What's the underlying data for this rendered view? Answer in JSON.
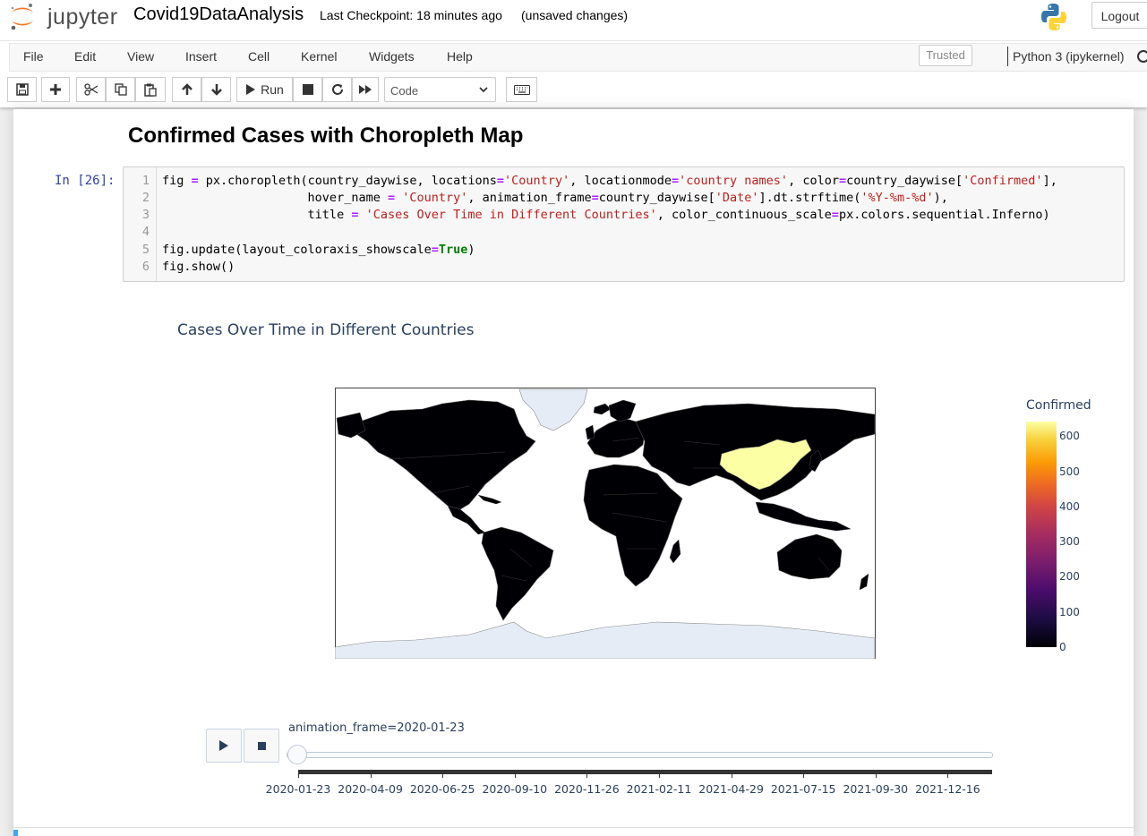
{
  "header": {
    "logo_text": "jupyter",
    "notebook_name": "Covid19DataAnalysis",
    "checkpoint": "Last Checkpoint: 18 minutes ago",
    "unsaved": "(unsaved changes)",
    "logout_label": "Logout"
  },
  "menubar": {
    "items": [
      "File",
      "Edit",
      "View",
      "Insert",
      "Cell",
      "Kernel",
      "Widgets",
      "Help"
    ],
    "trusted_label": "Trusted",
    "kernel_name": "Python 3 (ipykernel)"
  },
  "toolbar": {
    "run_label": "Run",
    "cell_type": "Code",
    "icons": [
      "save-icon",
      "plus-icon",
      "cut-icon",
      "copy-icon",
      "paste-icon",
      "arrow-up-icon",
      "arrow-down-icon",
      "play-icon",
      "stop-icon",
      "restart-icon",
      "fast-forward-icon",
      "keyboard-icon"
    ]
  },
  "notebook": {
    "markdown_title": "Confirmed Cases with Choropleth Map",
    "prompt": "In [26]:",
    "code_lines": [
      "fig = px.choropleth(country_daywise, locations='Country', locationmode='country names', color=country_daywise['Confirmed'],",
      "                    hover_name = 'Country', animation_frame=country_daywise['Date'].dt.strftime('%Y-%m-%d'),",
      "                    title = 'Cases Over Time in Different Countries', color_continuous_scale=px.colors.sequential.Inferno)",
      "",
      "fig.update(layout_coloraxis_showscale=True)",
      "fig.show()"
    ],
    "line_numbers": [
      "1",
      "2",
      "3",
      "4",
      "5",
      "6"
    ]
  },
  "plot": {
    "title": "Cases Over Time in Different Countries",
    "colorbar_title": "Confirmed",
    "colorbar_ticks": [
      "600",
      "500",
      "400",
      "300",
      "200",
      "100",
      "0"
    ],
    "colorscale": "Inferno",
    "highlighted_country_color": "#fcffa4",
    "base_country_color": "#000004",
    "animation_label": "animation_frame=2020-01-23",
    "slider_ticks": [
      "2020-01-23",
      "2020-04-09",
      "2020-06-25",
      "2020-09-10",
      "2020-11-26",
      "2021-02-11",
      "2021-04-29",
      "2021-07-15",
      "2021-09-30",
      "2021-12-16"
    ],
    "slider_position": 0
  }
}
